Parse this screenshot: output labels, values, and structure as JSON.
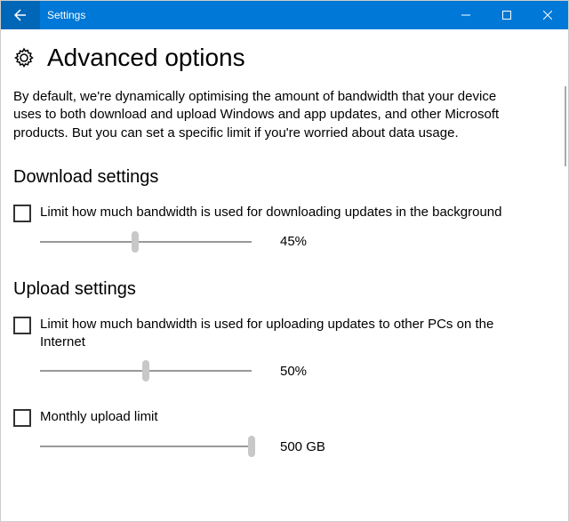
{
  "window": {
    "title": "Settings"
  },
  "page": {
    "title": "Advanced options",
    "description": "By default, we're dynamically optimising the amount of bandwidth that your device uses to both download and upload Windows and app updates, and other Microsoft products. But you can set a specific limit if you're worried about data usage."
  },
  "download": {
    "heading": "Download settings",
    "limit_label": "Limit how much bandwidth is used for downloading updates in the background",
    "limit_checked": false,
    "slider_percent": 45,
    "slider_display": "45%"
  },
  "upload": {
    "heading": "Upload settings",
    "limit_label": "Limit how much bandwidth is used for uploading updates to other PCs on the Internet",
    "limit_checked": false,
    "slider_percent": 50,
    "slider_display": "50%",
    "monthly_label": "Monthly upload limit",
    "monthly_checked": false,
    "monthly_slider_percent": 100,
    "monthly_display": "500 GB"
  }
}
